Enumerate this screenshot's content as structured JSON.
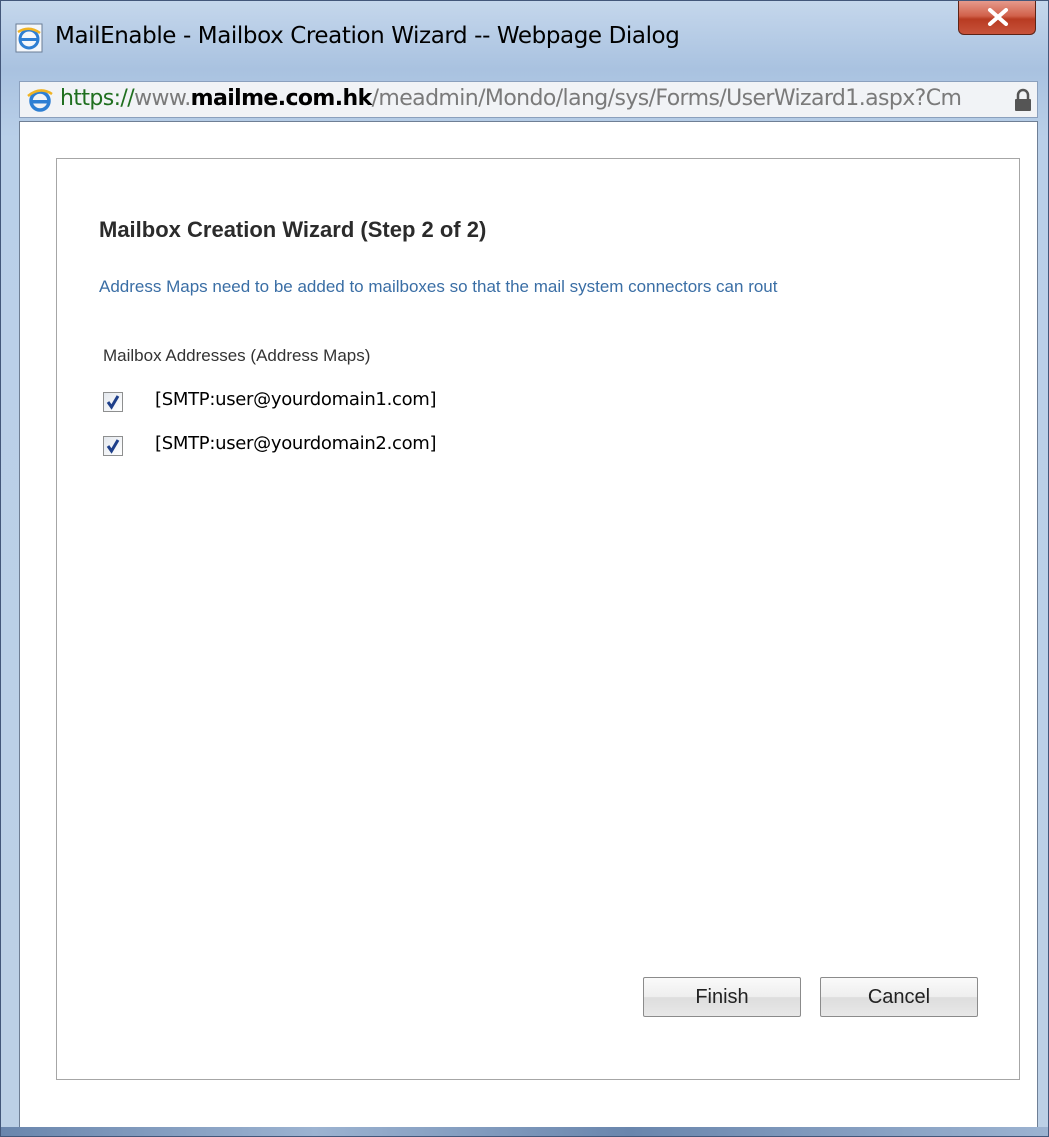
{
  "window": {
    "title": "MailEnable - Mailbox Creation Wizard -- Webpage Dialog"
  },
  "address_bar": {
    "scheme": "https://",
    "prefix": "www.",
    "host": "mailme.com.hk",
    "path": "/meadmin/Mondo/lang/sys/Forms/UserWizard1.aspx?Cm"
  },
  "wizard": {
    "title": "Mailbox Creation Wizard (Step 2 of 2)",
    "description": "Address Maps need to be added to mailboxes so that the mail system connectors can rout",
    "section_label": "Mailbox Addresses (Address Maps)",
    "addresses": [
      {
        "label": "[SMTP:user@yourdomain1.com]",
        "checked": true
      },
      {
        "label": "[SMTP:user@yourdomain2.com]",
        "checked": true
      }
    ],
    "finish_label": "Finish",
    "cancel_label": "Cancel"
  },
  "colors": {
    "description_text": "#3a6ea5",
    "close_button": "#c8533b"
  }
}
